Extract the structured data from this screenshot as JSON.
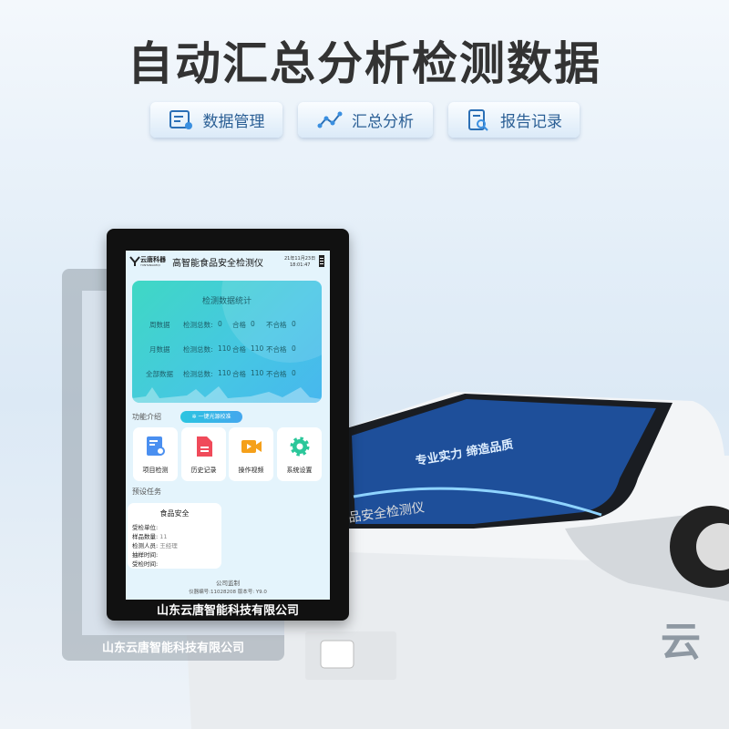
{
  "headline": "自动汇总分析检测数据",
  "features": [
    {
      "label": "数据管理",
      "icon": "data-management-icon"
    },
    {
      "label": "汇总分析",
      "icon": "line-chart-icon"
    },
    {
      "label": "报告记录",
      "icon": "report-search-icon"
    }
  ],
  "tablet": {
    "brand": "云唐科器",
    "brand_sub": "YUNTANGKEQI",
    "app_title": "高智能食品安全检测仪",
    "date": "21年11月23日",
    "time": "18:01:47",
    "stats": {
      "title": "检测数据统计",
      "rows": [
        {
          "period": "周数据",
          "total_label": "检测总数:",
          "total": "0",
          "pass_label": "合格",
          "pass": "0",
          "fail_label": "不合格",
          "fail": "0"
        },
        {
          "period": "月数据",
          "total_label": "检测总数:",
          "total": "110",
          "pass_label": "合格",
          "pass": "110",
          "fail_label": "不合格",
          "fail": "0"
        },
        {
          "period": "全部数据",
          "total_label": "检测总数:",
          "total": "110",
          "pass_label": "合格",
          "pass": "110",
          "fail_label": "不合格",
          "fail": "0"
        }
      ]
    },
    "functions_label": "功能介绍",
    "calibrate_button": "一键光源校准",
    "functions": [
      {
        "label": "项目检测",
        "color": "#4a8ff0"
      },
      {
        "label": "历史记录",
        "color": "#f04a5a"
      },
      {
        "label": "操作视频",
        "color": "#f5a01a"
      },
      {
        "label": "系统设置",
        "color": "#2bc79a"
      }
    ],
    "preset_label": "预设任务",
    "task": {
      "title": "食品安全",
      "fields": [
        {
          "key": "受检单位:",
          "value": ""
        },
        {
          "key": "样品数量:",
          "value": "11"
        },
        {
          "key": "检测人员:",
          "value": "王经理"
        },
        {
          "key": "抽样时间:",
          "value": ""
        },
        {
          "key": "受检时间:",
          "value": ""
        }
      ]
    },
    "footer_supervise": "公司监制",
    "footer_info": "仪器编号:11028208  版本号: Y9.0",
    "bezel_company": "山东云唐智能科技有限公司"
  },
  "ghost_company": "山东云唐智能科技有限公司",
  "machine": {
    "screen_slogan": "专业实力 缔造品质",
    "label": "品安全检测仪",
    "logo": "云"
  }
}
